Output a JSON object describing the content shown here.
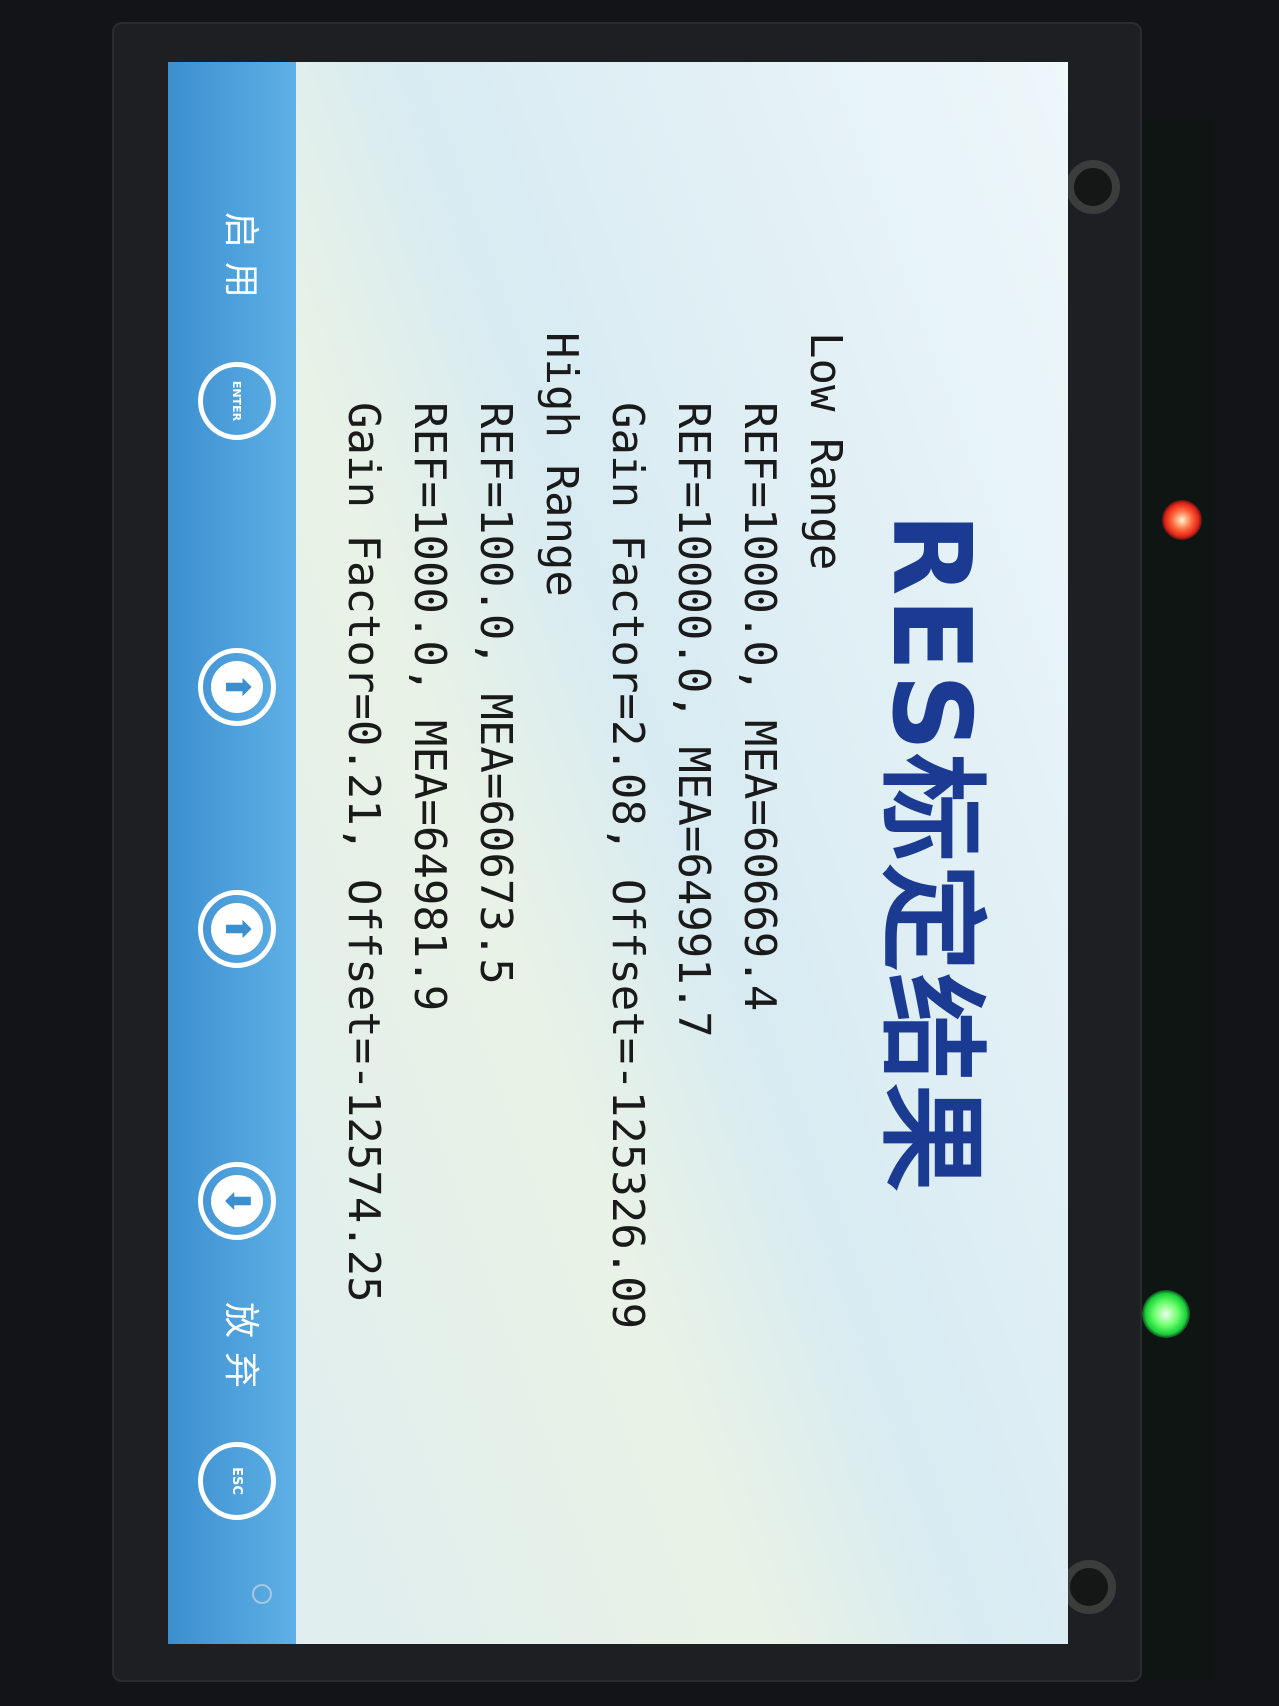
{
  "screen": {
    "title": "RES标定结果"
  },
  "results": {
    "low_range_label": "Low Range",
    "low_ref1": "REF=1000.0, MEA=60669.4",
    "low_ref2": "REF=10000.0, MEA=64991.7",
    "low_gain": "Gain Factor=2.08, Offset=-125326.09",
    "high_range_label": "High Range",
    "high_ref1": "REF=100.0, MEA=60673.5",
    "high_ref2": "REF=1000.0, MEA=64981.9",
    "high_gain": "Gain Factor=0.21, Offset=-12574.25"
  },
  "toolbar": {
    "esc_icon": "ESC",
    "discard_label": "放弃",
    "down_arrow": "⬇",
    "up_arrow": "⬆",
    "up_arrow2": "⬆",
    "enter_icon": "ENTER",
    "enable_label": "启用"
  },
  "colors": {
    "title": "#1b3b92",
    "toolbar": "#3b8fcf",
    "screen_bg": "#dcecf2"
  }
}
